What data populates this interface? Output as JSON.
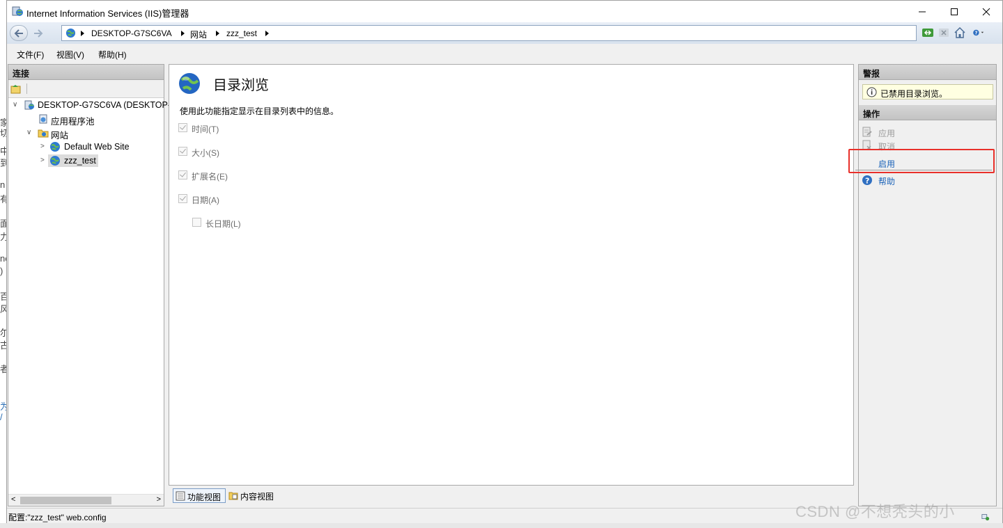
{
  "window": {
    "title": "Internet Information Services (IIS)管理器"
  },
  "address": {
    "crumbs": [
      "DESKTOP-G7SC6VA",
      "网站",
      "zzz_test"
    ]
  },
  "menu": {
    "file": "文件(F)",
    "view": "视图(V)",
    "help": "帮助(H)"
  },
  "connections": {
    "header": "连接",
    "tree": {
      "server": "DESKTOP-G7SC6VA (DESKTOP-",
      "app_pools": "应用程序池",
      "sites": "网站",
      "default_site": "Default Web Site",
      "selected_site": "zzz_test"
    }
  },
  "feature": {
    "title": "目录浏览",
    "description": "使用此功能指定显示在目录列表中的信息。",
    "options": [
      {
        "label": "时间(T)",
        "checked": true
      },
      {
        "label": "大小(S)",
        "checked": true
      },
      {
        "label": "扩展名(E)",
        "checked": true
      },
      {
        "label": "日期(A)",
        "checked": true
      },
      {
        "label": "长日期(L)",
        "checked": false
      }
    ]
  },
  "bottom_tabs": {
    "features_view": "功能视图",
    "content_view": "内容视图"
  },
  "alerts": {
    "header": "警报",
    "message": "已禁用目录浏览。"
  },
  "actions": {
    "header": "操作",
    "apply": "应用",
    "cancel": "取消",
    "enable": "启用",
    "help": "帮助"
  },
  "status": {
    "text": "配置:\"zzz_test\" web.config"
  },
  "watermark": "CSDN @不想秃头的小",
  "colors": {
    "link": "#1a62b8",
    "highlight_box": "#e8302a",
    "alert_bg": "#ffffe1"
  }
}
